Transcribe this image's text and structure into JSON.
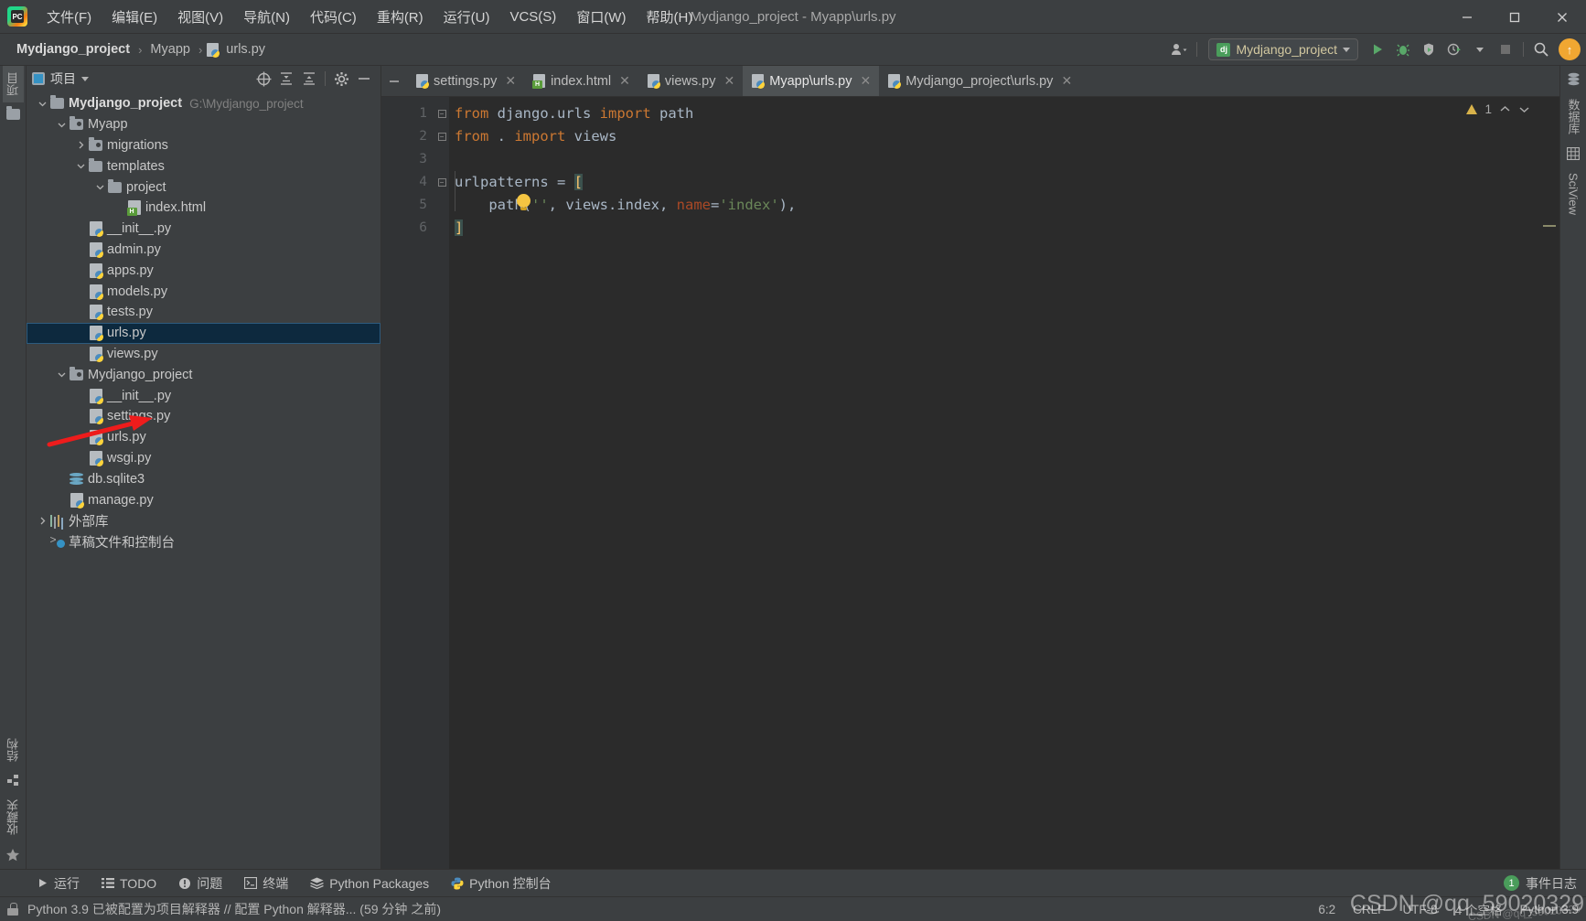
{
  "window": {
    "title": "Mydjango_project - Myapp\\urls.py",
    "minimize": "—",
    "maximize": "□",
    "close": "✕"
  },
  "menubar": {
    "items": [
      {
        "label": "文件(F)",
        "name": "menu-file"
      },
      {
        "label": "编辑(E)",
        "name": "menu-edit"
      },
      {
        "label": "视图(V)",
        "name": "menu-view"
      },
      {
        "label": "导航(N)",
        "name": "menu-navigate"
      },
      {
        "label": "代码(C)",
        "name": "menu-code"
      },
      {
        "label": "重构(R)",
        "name": "menu-refactor"
      },
      {
        "label": "运行(U)",
        "name": "menu-run"
      },
      {
        "label": "VCS(S)",
        "name": "menu-vcs"
      },
      {
        "label": "窗口(W)",
        "name": "menu-window"
      },
      {
        "label": "帮助(H)",
        "name": "menu-help"
      }
    ]
  },
  "navbar": {
    "breadcrumbs": [
      {
        "label": "Mydjango_project",
        "bold": true
      },
      {
        "label": "Myapp",
        "bold": false
      },
      {
        "label": "urls.py",
        "bold": false,
        "icon": "python-file-icon"
      }
    ],
    "separator": "›",
    "run_config": {
      "label": "Mydjango_project",
      "badge": "dj"
    },
    "update_badge": "↑"
  },
  "project_panel": {
    "title": "项目",
    "tree": [
      {
        "indent": 0,
        "twisty": "down",
        "icon": "folder",
        "label": "Mydjango_project",
        "bold": true,
        "sub": "G:\\Mydjango_project"
      },
      {
        "indent": 1,
        "twisty": "down",
        "icon": "folder-src",
        "label": "Myapp"
      },
      {
        "indent": 2,
        "twisty": "right",
        "icon": "folder-src",
        "label": "migrations"
      },
      {
        "indent": 2,
        "twisty": "down",
        "icon": "folder",
        "label": "templates"
      },
      {
        "indent": 3,
        "twisty": "down",
        "icon": "folder",
        "label": "project"
      },
      {
        "indent": 4,
        "twisty": "none",
        "icon": "html",
        "label": "index.html"
      },
      {
        "indent": 2,
        "twisty": "none",
        "icon": "python",
        "label": "__init__.py"
      },
      {
        "indent": 2,
        "twisty": "none",
        "icon": "python",
        "label": "admin.py"
      },
      {
        "indent": 2,
        "twisty": "none",
        "icon": "python",
        "label": "apps.py"
      },
      {
        "indent": 2,
        "twisty": "none",
        "icon": "python",
        "label": "models.py"
      },
      {
        "indent": 2,
        "twisty": "none",
        "icon": "python",
        "label": "tests.py"
      },
      {
        "indent": 2,
        "twisty": "none",
        "icon": "python",
        "label": "urls.py",
        "selected": true
      },
      {
        "indent": 2,
        "twisty": "none",
        "icon": "python",
        "label": "views.py"
      },
      {
        "indent": 1,
        "twisty": "down",
        "icon": "folder-src",
        "label": "Mydjango_project"
      },
      {
        "indent": 2,
        "twisty": "none",
        "icon": "python",
        "label": "__init__.py"
      },
      {
        "indent": 2,
        "twisty": "none",
        "icon": "python",
        "label": "settings.py"
      },
      {
        "indent": 2,
        "twisty": "none",
        "icon": "python",
        "label": "urls.py"
      },
      {
        "indent": 2,
        "twisty": "none",
        "icon": "python",
        "label": "wsgi.py"
      },
      {
        "indent": 1,
        "twisty": "none",
        "icon": "db",
        "label": "db.sqlite3"
      },
      {
        "indent": 1,
        "twisty": "none",
        "icon": "python",
        "label": "manage.py"
      },
      {
        "indent": 0,
        "twisty": "right",
        "icon": "lib",
        "label": "外部库"
      },
      {
        "indent": 0,
        "twisty": "none",
        "icon": "scratch",
        "label": "草稿文件和控制台"
      }
    ]
  },
  "left_rail": {
    "top": [
      {
        "label": "项目",
        "name": "tool-project"
      }
    ],
    "bottom": [
      {
        "label": "结构",
        "name": "tool-structure"
      },
      {
        "label": "收藏夹",
        "name": "tool-favorites"
      }
    ]
  },
  "right_rail": {
    "items": [
      {
        "label": "数据库",
        "name": "tool-database"
      },
      {
        "label": "SciView",
        "name": "tool-sciview"
      }
    ]
  },
  "tabs": [
    {
      "label": "settings.py",
      "icon": "python-file-icon",
      "active": false
    },
    {
      "label": "index.html",
      "icon": "html-file-icon",
      "active": false
    },
    {
      "label": "views.py",
      "icon": "python-file-icon",
      "active": false
    },
    {
      "label": "Myapp\\urls.py",
      "icon": "python-file-icon",
      "active": true
    },
    {
      "label": "Mydjango_project\\urls.py",
      "icon": "python-file-icon",
      "active": false
    }
  ],
  "editor": {
    "line_numbers": [
      "1",
      "2",
      "3",
      "4",
      "5",
      "6"
    ],
    "warning_count": "1",
    "lines": [
      {
        "n": 1,
        "tokens": [
          {
            "t": "from ",
            "c": "kw"
          },
          {
            "t": "django.urls ",
            "c": "pl"
          },
          {
            "t": "import ",
            "c": "kw"
          },
          {
            "t": "path",
            "c": "pl"
          }
        ]
      },
      {
        "n": 2,
        "tokens": [
          {
            "t": "from ",
            "c": "kw"
          },
          {
            "t": ". ",
            "c": "pl"
          },
          {
            "t": "import ",
            "c": "kw"
          },
          {
            "t": "views",
            "c": "pl"
          }
        ]
      },
      {
        "n": 3,
        "tokens": []
      },
      {
        "n": 4,
        "tokens": [
          {
            "t": "urlpatterns = ",
            "c": "pl"
          },
          {
            "t": "[",
            "c": "brk-hl"
          }
        ]
      },
      {
        "n": 5,
        "tokens": [
          {
            "t": "    path(",
            "c": "pl"
          },
          {
            "t": "''",
            "c": "str"
          },
          {
            "t": ", views.index, ",
            "c": "pl"
          },
          {
            "t": "name",
            "c": "kwarg"
          },
          {
            "t": "=",
            "c": "pl"
          },
          {
            "t": "'index'",
            "c": "str"
          },
          {
            "t": "),",
            "c": "pl"
          }
        ]
      },
      {
        "n": 6,
        "tokens": [
          {
            "t": "]",
            "c": "brk-hl"
          }
        ]
      }
    ]
  },
  "bottom_tools": [
    {
      "label": "运行",
      "icon": "run-icon",
      "name": "tool-run"
    },
    {
      "label": "TODO",
      "icon": "todo-icon",
      "name": "tool-todo"
    },
    {
      "label": "问题",
      "icon": "problems-icon",
      "name": "tool-problems"
    },
    {
      "label": "终端",
      "icon": "terminal-icon",
      "name": "tool-terminal"
    },
    {
      "label": "Python Packages",
      "icon": "packages-icon",
      "name": "tool-python-packages"
    },
    {
      "label": "Python 控制台",
      "icon": "python-console-icon",
      "name": "tool-python-console"
    }
  ],
  "event_log": {
    "count": "1",
    "label": "事件日志"
  },
  "statusbar": {
    "message": "Python 3.9 已被配置为项目解释器 // 配置 Python 解释器... (59 分钟 之前)",
    "caret": "6:2",
    "line_sep": "CRLF",
    "encoding": "UTF-8",
    "indent": "4 个空格",
    "interpreter": "Python 3.9"
  },
  "watermark": {
    "text": "CSDN @qq_59020329",
    "small": "CSDN @qq_59020329"
  }
}
